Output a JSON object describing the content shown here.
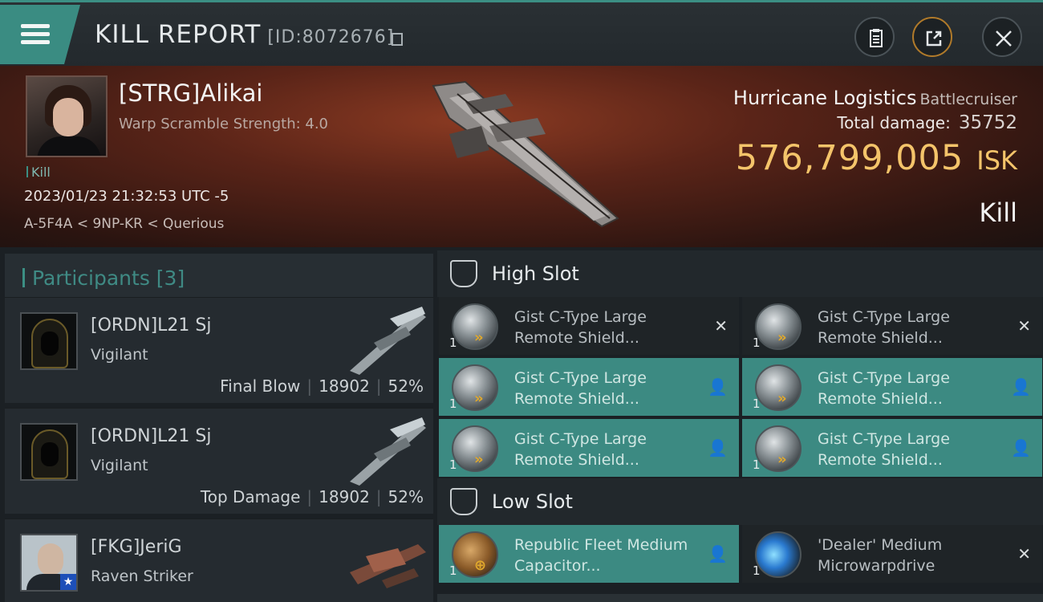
{
  "header": {
    "title": "KILL REPORT",
    "report_id": "[ID:8072676]",
    "icons": [
      "menu-icon",
      "copy-icon",
      "clipboard-icon",
      "share-icon",
      "close-icon"
    ]
  },
  "victim": {
    "name": "[STRG]Alikai",
    "scramble": "Warp Scramble Strength: 4.0",
    "kill_tag": "Kill",
    "datetime": "2023/01/23 21:32:53 UTC -5",
    "location": "A-5F4A < 9NP-KR < Querious",
    "ship_name": "Hurricane Logistics",
    "ship_class": "Battlecruiser",
    "total_damage_label": "Total damage:",
    "total_damage": "35752",
    "isk_value": "576,799,005",
    "isk_unit": "ISK",
    "result": "Kill"
  },
  "participants": {
    "header": "Participants [3]",
    "rows": [
      {
        "name": "[ORDN]L21 Sj",
        "ship": "Vigilant",
        "tag": "Final Blow",
        "damage": "18902",
        "percent": "52%"
      },
      {
        "name": "[ORDN]L21 Sj",
        "ship": "Vigilant",
        "tag": "Top Damage",
        "damage": "18902",
        "percent": "52%"
      },
      {
        "name": "[FKG]JeriG",
        "ship": "Raven Striker",
        "tag": "",
        "damage": "",
        "percent": ""
      }
    ]
  },
  "fittings": {
    "high_slot_label": "High Slot",
    "low_slot_label": "Low Slot",
    "high": [
      {
        "qty": "1",
        "name": "Gist C-Type Large Remote Shield...",
        "status": "destroyed"
      },
      {
        "qty": "1",
        "name": "Gist C-Type Large Remote Shield...",
        "status": "destroyed"
      },
      {
        "qty": "1",
        "name": "Gist C-Type Large Remote Shield...",
        "status": "dropped"
      },
      {
        "qty": "1",
        "name": "Gist C-Type Large Remote Shield...",
        "status": "dropped"
      },
      {
        "qty": "1",
        "name": "Gist C-Type Large Remote Shield...",
        "status": "dropped"
      },
      {
        "qty": "1",
        "name": "Gist C-Type Large Remote Shield...",
        "status": "dropped"
      }
    ],
    "low": [
      {
        "qty": "1",
        "name": "Republic Fleet Medium Capacitor...",
        "status": "dropped"
      },
      {
        "qty": "1",
        "name": "'Dealer' Medium Microwarpdrive",
        "status": "destroyed"
      }
    ]
  },
  "colors": {
    "accent_teal": "#3c8a82",
    "isk_gold": "#f4c46a",
    "banner_red": "#5a2418"
  }
}
